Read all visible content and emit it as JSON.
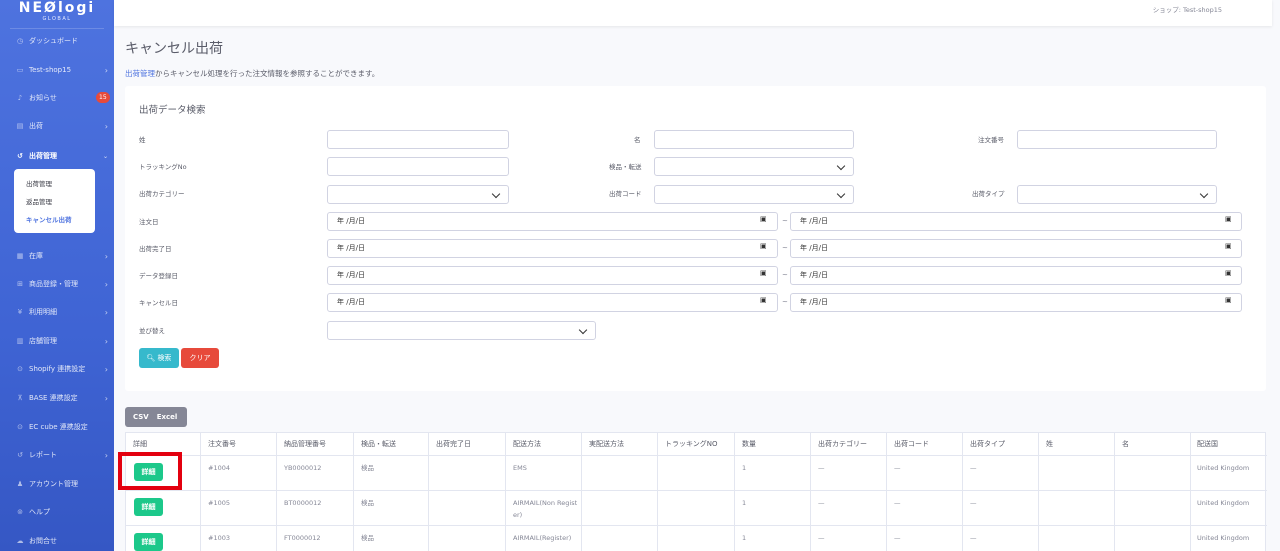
{
  "brand": {
    "main": "NEØlogi",
    "sub": "GLOBAL"
  },
  "topbar": {
    "shop_label": "ショップ: Test-shop15"
  },
  "sidebar": {
    "items": [
      {
        "label": "ダッシュボード",
        "icon": "dashboard-icon"
      },
      {
        "label": "Test-shop15",
        "icon": "shop-icon"
      },
      {
        "label": "お知らせ",
        "icon": "bell-icon",
        "badge": "15"
      },
      {
        "label": "出荷",
        "icon": "truck-icon"
      },
      {
        "label": "出荷管理",
        "icon": "history-icon"
      },
      {
        "label": "在庫",
        "icon": "warehouse-icon"
      },
      {
        "label": "商品登録・管理",
        "icon": "sitemap-icon"
      },
      {
        "label": "利用明細",
        "icon": "yen-icon"
      },
      {
        "label": "店舗管理",
        "icon": "store-icon"
      },
      {
        "label": "Shopify 連携設定",
        "icon": "link-icon"
      },
      {
        "label": "BASE 連携設定",
        "icon": "link-icon"
      },
      {
        "label": "EC cube 連携設定",
        "icon": "link-icon"
      },
      {
        "label": "レポート",
        "icon": "report-icon"
      },
      {
        "label": "アカウント管理",
        "icon": "user-icon"
      },
      {
        "label": "ヘルプ",
        "icon": "help-icon"
      },
      {
        "label": "お問合せ",
        "icon": "chat-icon"
      }
    ],
    "submenu": [
      "出荷管理",
      "返品管理",
      "キャンセル出荷"
    ]
  },
  "page": {
    "title": "キャンセル出荷",
    "desc_link": "出荷管理",
    "desc_text": "からキャンセル処理を行った注文情報を参照することができます。"
  },
  "search": {
    "title": "出荷データ検索",
    "labels": {
      "last_name": "姓",
      "first_name": "名",
      "order_no": "注文番号",
      "tracking": "トラッキングNo",
      "inspect": "検品・転送",
      "category": "出荷カテゴリー",
      "ship_code": "出荷コード",
      "ship_type": "出荷タイプ",
      "order_date": "注文日",
      "ship_done_date": "出荷完了日",
      "data_date": "データ登録日",
      "cancel_date": "キャンセル日",
      "sort": "並び替え"
    },
    "date_placeholder": "年 /月/日",
    "tilde": "~",
    "search_button": "検索",
    "clear_button": "クリア"
  },
  "export": {
    "csv": "CSV",
    "excel": "Excel"
  },
  "table": {
    "headers": [
      "詳細",
      "注文番号",
      "納品管理番号",
      "検品・転送",
      "出荷完了日",
      "配送方法",
      "実配送方法",
      "トラッキングNO",
      "数量",
      "出荷カテゴリー",
      "出荷コード",
      "出荷タイプ",
      "姓",
      "名",
      "配送国"
    ],
    "detail_button": "詳細",
    "rows": [
      [
        "#1004",
        "YB0000012",
        "検品",
        "",
        "EMS",
        "",
        "",
        "1",
        "—",
        "—",
        "—",
        "",
        "",
        "United Kingdom"
      ],
      [
        "#1005",
        "BT0000012",
        "検品",
        "",
        "AIRMAIL(Non Register)",
        "",
        "",
        "1",
        "—",
        "—",
        "—",
        "",
        "",
        "United Kingdom"
      ],
      [
        "#1003",
        "FT0000012",
        "検品",
        "",
        "AIRMAIL(Register)",
        "",
        "",
        "1",
        "—",
        "—",
        "—",
        "",
        "",
        "United Kingdom"
      ]
    ]
  },
  "colors": {
    "primary": "#4e73df",
    "info": "#36b9cc",
    "danger": "#e74a3b",
    "success": "#1cc88a",
    "highlight": "#e3000f"
  }
}
